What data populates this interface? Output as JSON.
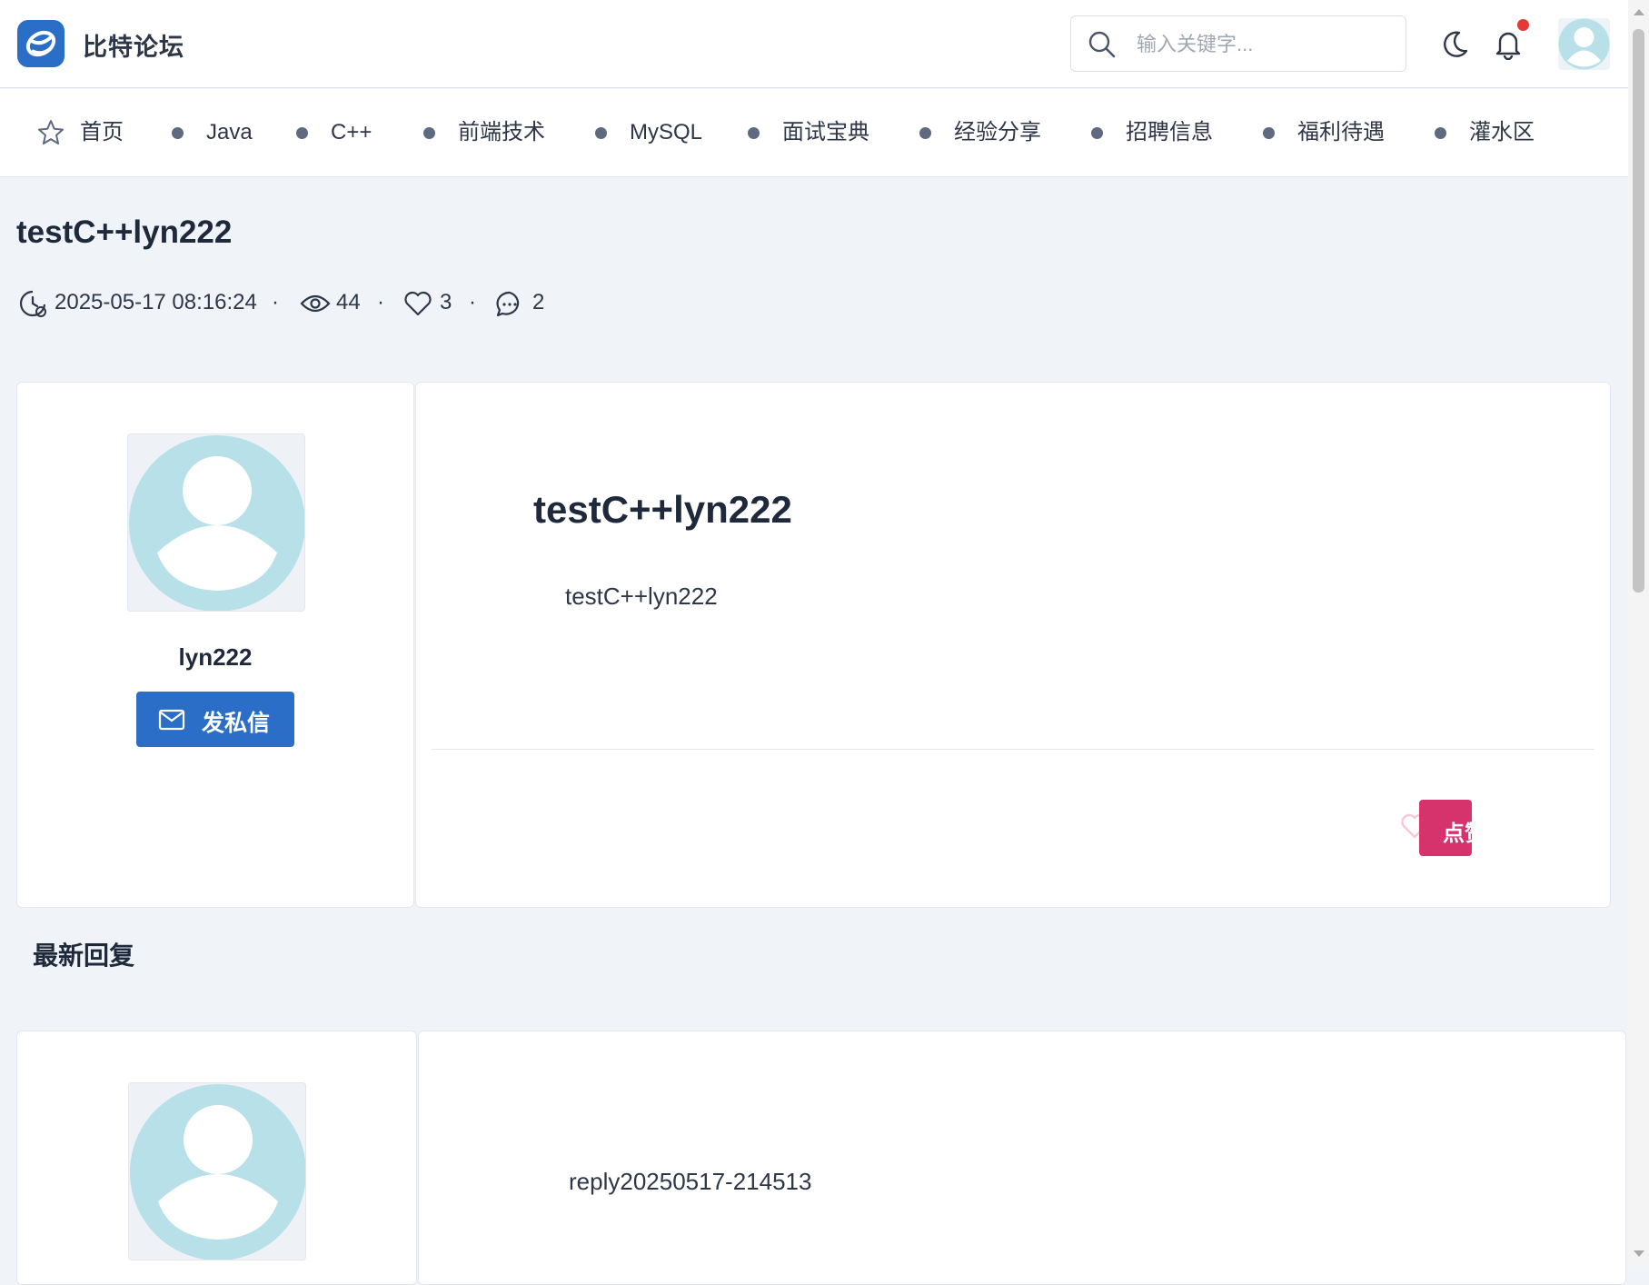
{
  "header": {
    "logo_icon": "forum-logo-icon",
    "site_name": "比特论坛",
    "search_placeholder": "输入关键字...",
    "theme_icon": "moon-icon",
    "notification_icon": "bell-icon",
    "notification_badge_color": "#e53935"
  },
  "nav": {
    "items": [
      {
        "label": "首页",
        "icon": "star-icon"
      },
      {
        "label": "Java"
      },
      {
        "label": "C++"
      },
      {
        "label": "前端技术"
      },
      {
        "label": "MySQL"
      },
      {
        "label": "面试宝典"
      },
      {
        "label": "经验分享"
      },
      {
        "label": "招聘信息"
      },
      {
        "label": "福利待遇"
      },
      {
        "label": "灌水区"
      }
    ]
  },
  "post": {
    "title": "testC++lyn222",
    "created_at": "2025-05-17 08:16:24",
    "views": "44",
    "likes": "3",
    "replies": "2",
    "separator": "·",
    "author": "lyn222",
    "pm_button": "发私信",
    "content_title": "testC++lyn222",
    "content_body": "testC++lyn222",
    "like_button": "点赞"
  },
  "replies_section": {
    "title": "最新回复",
    "items": [
      {
        "content": "reply20250517-214513"
      }
    ]
  },
  "colors": {
    "primary": "#2a6ec7",
    "like": "#d6336c",
    "page_bg": "#f0f4f9",
    "avatar": "#b8e0e8"
  }
}
